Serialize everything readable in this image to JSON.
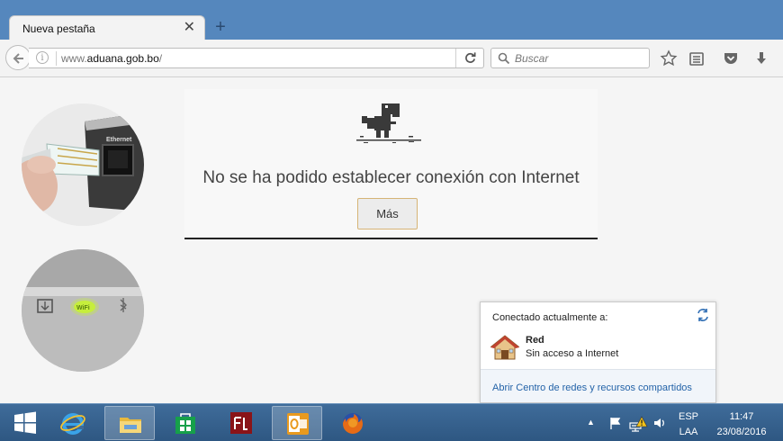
{
  "browser": {
    "tab_title": "Nueva pestaña",
    "tab_close": "✕",
    "new_tab": "+",
    "url_prefix": "www.",
    "url_host": "aduana.gob.bo",
    "url_suffix": "/",
    "search_placeholder": "Buscar"
  },
  "photos": {
    "ethernet_label": "Ethernet",
    "router_led_label": "WiFi"
  },
  "error_page": {
    "title": "No se ha podido establecer conexión con Internet",
    "more_button": "Más"
  },
  "network_popup": {
    "connected_label": "Conectado actualmente a:",
    "network_name": "Red",
    "network_status": "Sin acceso a Internet",
    "footer_link": "Abrir Centro de redes y recursos compartidos"
  },
  "taskbar": {
    "apps": [
      "start-button",
      "internet-explorer",
      "file-explorer",
      "store",
      "flash",
      "outlook",
      "firefox"
    ],
    "tray_arrow": "▲",
    "lang_top": "ESP",
    "lang_bottom": "LAA",
    "time": "11:47",
    "date": "23/08/2016"
  },
  "colors": {
    "tabstrip": "#5587bd",
    "taskbar": "#2e5782",
    "link": "#2463a8"
  }
}
